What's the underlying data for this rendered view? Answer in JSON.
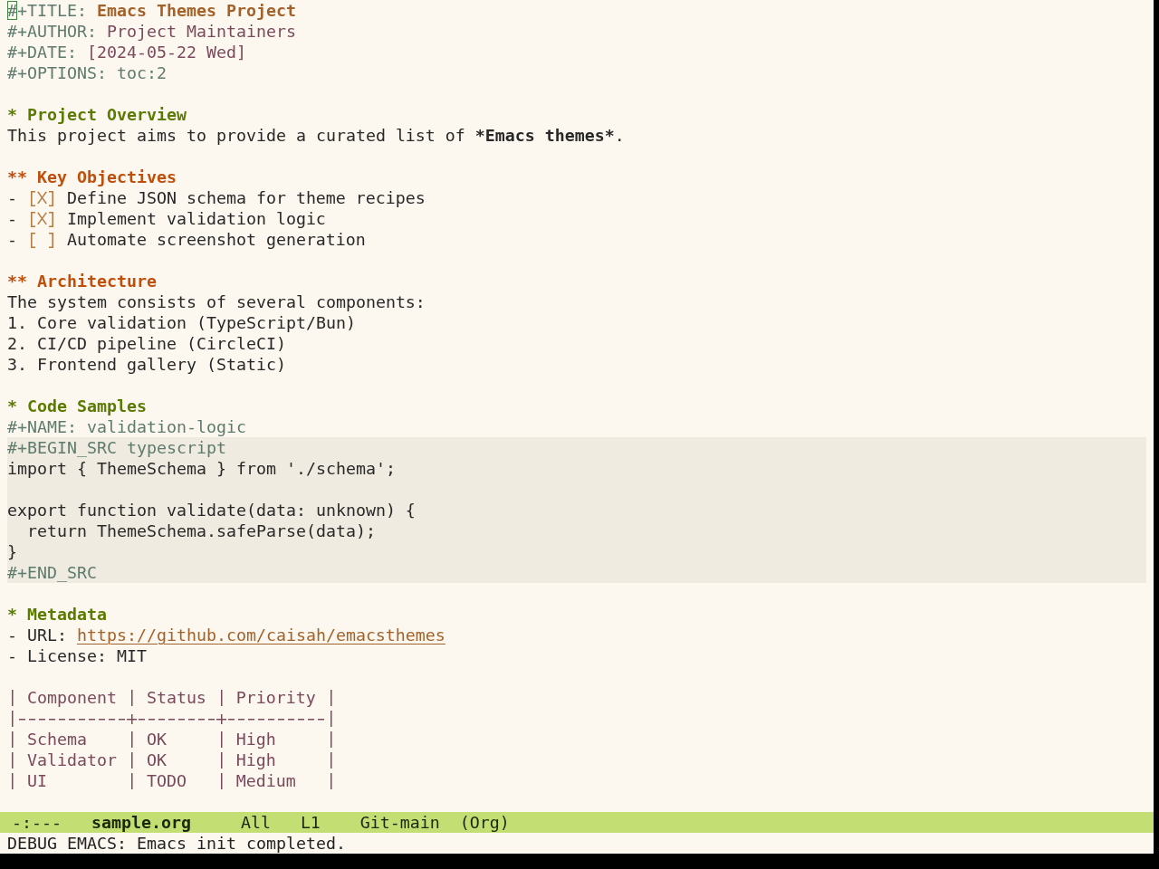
{
  "buffer": {
    "keywords": [
      {
        "key": "#+TITLE:",
        "value": "Emacs Themes Project",
        "kind": "title",
        "cursor": true
      },
      {
        "key": "#+AUTHOR:",
        "value": "Project Maintainers",
        "kind": "info",
        "cursor": false
      },
      {
        "key": "#+DATE:",
        "value": "[2024-05-22 Wed]",
        "kind": "info",
        "cursor": false
      },
      {
        "key": "#+OPTIONS:",
        "value": "toc:2",
        "kind": "setting",
        "cursor": false
      }
    ],
    "outline": [
      {
        "marker": "*",
        "title": "Project Overview",
        "body": [
          {
            "kind": "paragraph",
            "parts": [
              {
                "text": "This project aims to provide a curated list of ",
                "bold": false
              },
              {
                "text": "*Emacs themes*",
                "bold": true
              },
              {
                "text": ".",
                "bold": false
              }
            ]
          }
        ],
        "children": [
          {
            "marker": "**",
            "title": "Key Objectives",
            "body": [
              {
                "kind": "checklist",
                "items": [
                  {
                    "bullet": "-",
                    "checked": true,
                    "text": "Define JSON schema for theme recipes"
                  },
                  {
                    "bullet": "-",
                    "checked": true,
                    "text": "Implement validation logic"
                  },
                  {
                    "bullet": "-",
                    "checked": false,
                    "text": "Automate screenshot generation"
                  }
                ]
              }
            ]
          },
          {
            "marker": "**",
            "title": "Architecture",
            "body": [
              {
                "kind": "paragraph",
                "parts": [
                  {
                    "text": "The system consists of several components:",
                    "bold": false
                  }
                ]
              },
              {
                "kind": "numbered",
                "items": [
                  {
                    "number": "1.",
                    "text": "Core validation (TypeScript/Bun)"
                  },
                  {
                    "number": "2.",
                    "text": "CI/CD pipeline (CircleCI)"
                  },
                  {
                    "number": "3.",
                    "text": "Frontend gallery (Static)"
                  }
                ]
              }
            ]
          }
        ]
      },
      {
        "marker": "*",
        "title": "Code Samples",
        "body": [
          {
            "kind": "keyword",
            "key": "#+NAME:",
            "value": "validation-logic"
          },
          {
            "kind": "source",
            "begin": "#+BEGIN_SRC",
            "language": "typescript",
            "code": "import { ThemeSchema } from './schema';\n\nexport function validate(data: unknown) {\n  return ThemeSchema.safeParse(data);\n}",
            "end": "#+END_SRC"
          }
        ]
      },
      {
        "marker": "*",
        "title": "Metadata",
        "body": [
          {
            "kind": "list",
            "items": [
              {
                "kind": "link",
                "bullet": "-",
                "label": "URL:",
                "url": "https://github.com/caisah/emacsthemes"
              },
              {
                "kind": "text",
                "bullet": "-",
                "text": "License: MIT"
              }
            ]
          },
          {
            "kind": "table",
            "columns": [
              "Component",
              "Status",
              "Priority"
            ],
            "rows": [
              [
                "Schema",
                "OK",
                "High"
              ],
              [
                "Validator",
                "OK",
                "High"
              ],
              [
                "UI",
                "TODO",
                "Medium"
              ]
            ]
          }
        ]
      }
    ]
  },
  "mode_line": {
    "state": "-:---",
    "buffer_name": "sample.org",
    "position": "All",
    "line": "L1",
    "branch": "Git-main",
    "mode": "(Org)"
  },
  "echo_area": "DEBUG EMACS: Emacs init completed."
}
